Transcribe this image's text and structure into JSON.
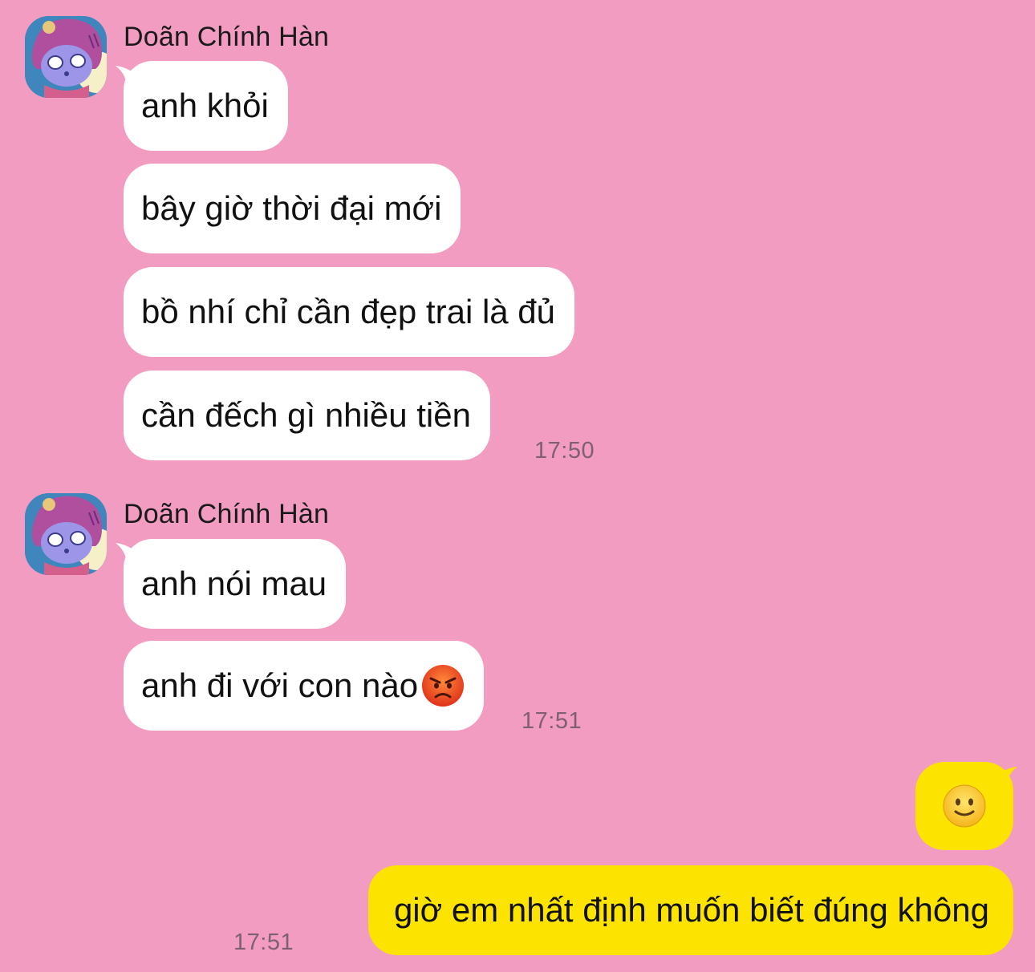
{
  "conversation": {
    "groups": [
      {
        "sender": "Doãn Chính Hàn",
        "avatar_icon": "cartoon-character-avatar",
        "messages": [
          "anh khỏi",
          "bây giờ thời đại mới",
          "bồ nhí chỉ cần đẹp trai là đủ",
          "cần đếch gì nhiều tiền"
        ],
        "time": "17:50"
      },
      {
        "sender": "Doãn Chính Hàn",
        "avatar_icon": "cartoon-character-avatar",
        "messages": [
          "anh nói mau",
          "anh đi với con nào"
        ],
        "trailing_emoji": "angry-face-emoji",
        "time": "17:51"
      }
    ],
    "outgoing": {
      "emoji_message": "slightly-smiling-face-emoji",
      "text": "giờ em nhất định muốn biết đúng không",
      "time": "17:51"
    }
  },
  "colors": {
    "background": "#f29cc2",
    "incoming_bubble": "#ffffff",
    "outgoing_bubble": "#fce300",
    "timestamp": "#7e5f73"
  }
}
